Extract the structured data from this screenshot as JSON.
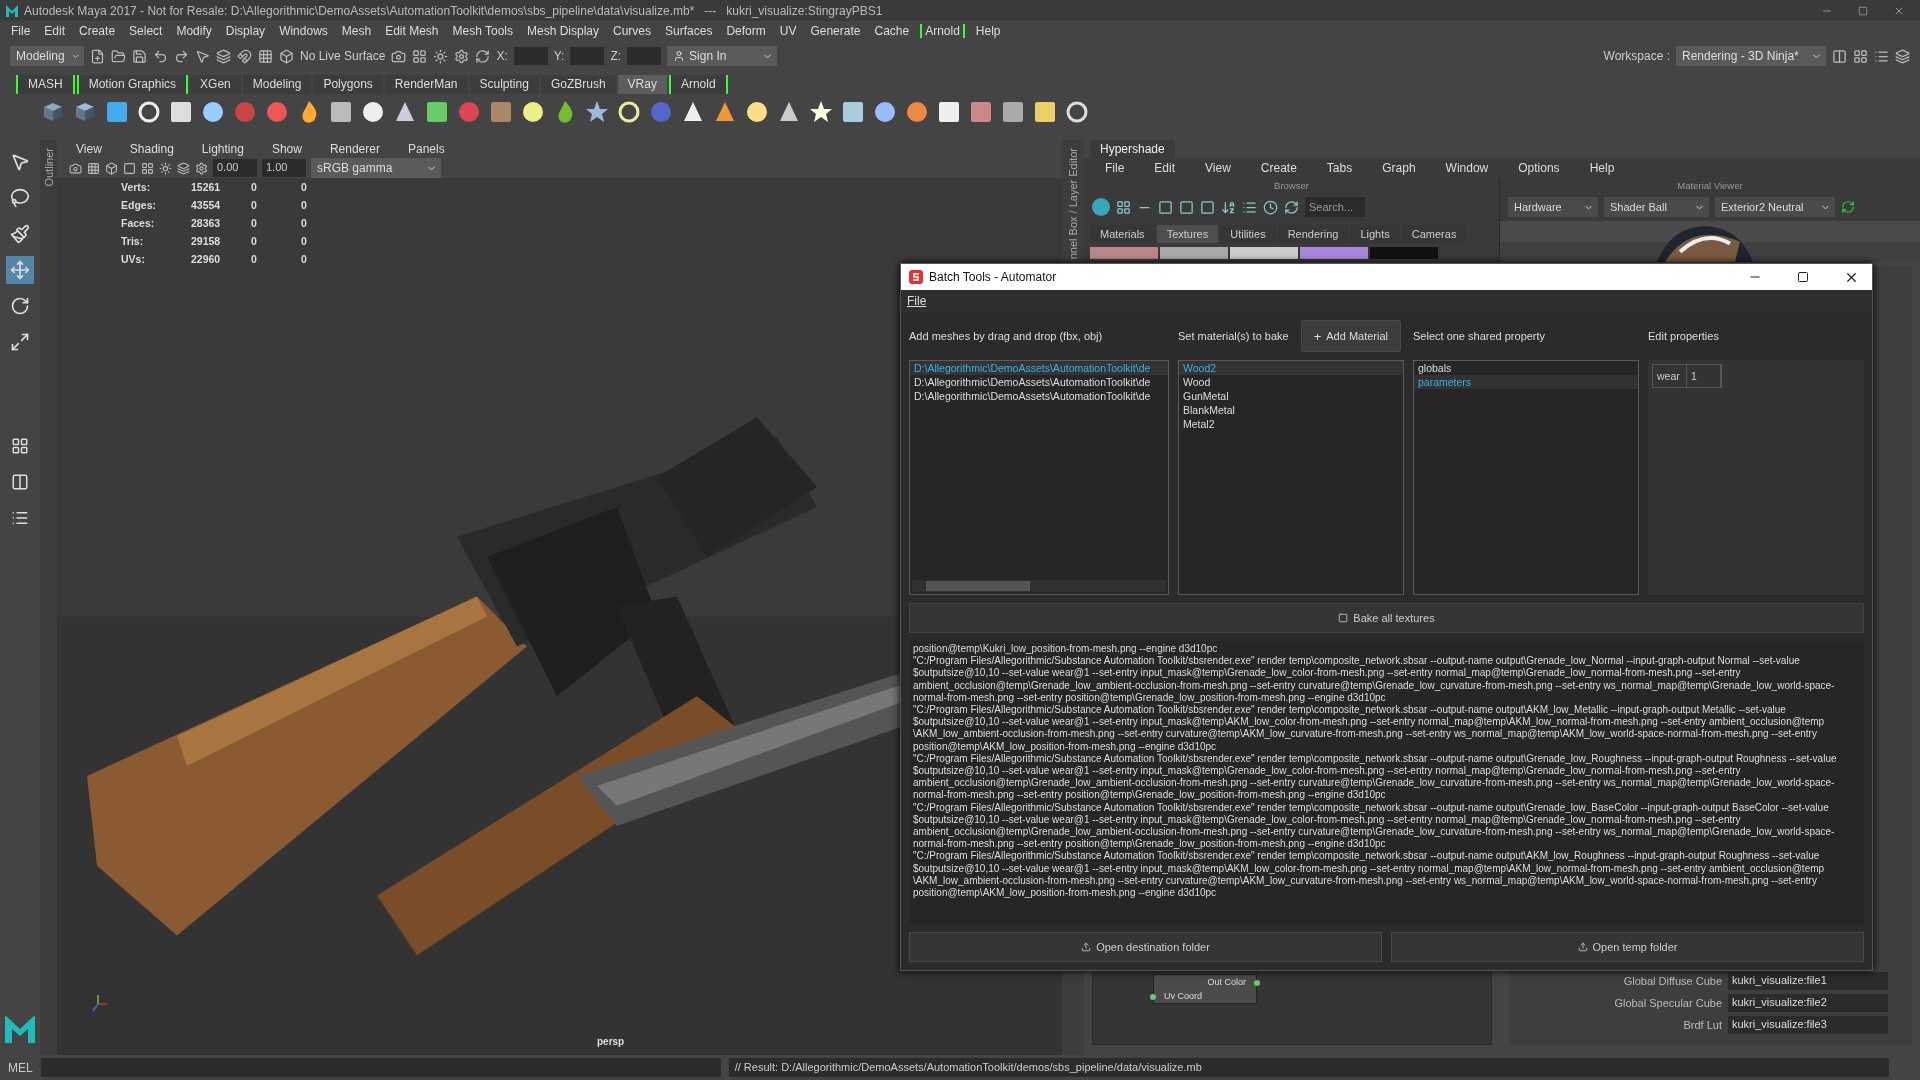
{
  "window": {
    "title": "Autodesk Maya 2017 - Not for Resale: D:\\Allegorithmic\\DemoAssets\\AutomationToolkit\\demos\\sbs_pipeline\\data\\visualize.mb*   ---   kukri_visualize:StingrayPBS1"
  },
  "menu_bar": [
    {
      "label": "File",
      "kind": "plain"
    },
    {
      "label": "Edit",
      "kind": "plain"
    },
    {
      "label": "Create",
      "kind": "plain"
    },
    {
      "label": "Select",
      "kind": "plain"
    },
    {
      "label": "Modify",
      "kind": "plain"
    },
    {
      "label": "Display",
      "kind": "plain"
    },
    {
      "label": "Windows",
      "kind": "plain"
    },
    {
      "label": "Mesh",
      "kind": "plain"
    },
    {
      "label": "Edit Mesh",
      "kind": "plain"
    },
    {
      "label": "Mesh Tools",
      "kind": "plain"
    },
    {
      "label": "Mesh Display",
      "kind": "plain"
    },
    {
      "label": "Curves",
      "kind": "plain"
    },
    {
      "label": "Surfaces",
      "kind": "plain"
    },
    {
      "label": "Deform",
      "kind": "plain"
    },
    {
      "label": "UV",
      "kind": "plain"
    },
    {
      "label": "Generate",
      "kind": "plain"
    },
    {
      "label": "Cache",
      "kind": "plain"
    },
    {
      "label": "Arnold",
      "kind": "plugin"
    },
    {
      "label": "Help",
      "kind": "plain"
    }
  ],
  "status_line": {
    "mode": "Modeling",
    "live_surface": "No Live Surface",
    "x_label": "X:",
    "y_label": "Y:",
    "z_label": "Z:",
    "sign_in": "Sign In",
    "workspace_label": "Workspace :",
    "workspace": "Rendering - 3D Ninja*"
  },
  "shelf_tabs": [
    {
      "label": "MASH",
      "kind": "plugin",
      "selected": false
    },
    {
      "label": "Motion Graphics",
      "kind": "plugin",
      "selected": false
    },
    {
      "label": "XGen",
      "kind": "plain",
      "selected": false
    },
    {
      "label": "Modeling",
      "kind": "plain",
      "selected": false
    },
    {
      "label": "Polygons",
      "kind": "plain",
      "selected": false
    },
    {
      "label": "RenderMan",
      "kind": "plain",
      "selected": false
    },
    {
      "label": "Sculpting",
      "kind": "plain",
      "selected": false
    },
    {
      "label": "GoZBrush",
      "kind": "plain",
      "selected": false
    },
    {
      "label": "VRay",
      "kind": "plain",
      "selected": true
    },
    {
      "label": "Arnold",
      "kind": "plugin",
      "selected": false
    }
  ],
  "outliner_tab": "Outliner",
  "viewport": {
    "menus": [
      "View",
      "Shading",
      "Lighting",
      "Show",
      "Renderer",
      "Panels"
    ],
    "exposure": "0.00",
    "gamma": "1.00",
    "color_space": "sRGB gamma",
    "stats": [
      {
        "label": "Verts:",
        "values": [
          "15261",
          "0",
          "0"
        ]
      },
      {
        "label": "Edges:",
        "values": [
          "43554",
          "0",
          "0"
        ]
      },
      {
        "label": "Faces:",
        "values": [
          "28363",
          "0",
          "0"
        ]
      },
      {
        "label": "Tris:",
        "values": [
          "29158",
          "0",
          "0"
        ]
      },
      {
        "label": "UVs:",
        "values": [
          "22960",
          "0",
          "0"
        ]
      }
    ],
    "camera": "persp"
  },
  "channel_box_tab": "nnel Box / Layer Editor",
  "hypershade": {
    "title": "Hypershade",
    "menus": [
      "File",
      "Edit",
      "View",
      "Create",
      "Tabs",
      "Graph",
      "Window",
      "Options",
      "Help"
    ],
    "browser_label": "Browser",
    "search_placeholder": "Search...",
    "tabs": [
      {
        "label": "Materials",
        "selected": false
      },
      {
        "label": "Textures",
        "selected": true
      },
      {
        "label": "Utilities",
        "selected": false
      },
      {
        "label": "Rendering",
        "selected": false
      },
      {
        "label": "Lights",
        "selected": false
      },
      {
        "label": "Cameras",
        "selected": false
      }
    ],
    "viewer_label": "Material Viewer",
    "renderer": "Hardware",
    "geometry": "Shader Ball",
    "environment": "Exterior2 Neutral",
    "node": {
      "output": "Out Color",
      "input": "Uv Coord"
    },
    "properties": [
      {
        "label": "Global Diffuse Cube",
        "value": "kukri_visualize:file1"
      },
      {
        "label": "Global Specular Cube",
        "value": "kukri_visualize:file2"
      },
      {
        "label": "Brdf Lut",
        "value": "kukri_visualize:file3"
      }
    ]
  },
  "command_line": {
    "language": "MEL",
    "result": "// Result: D:/Allegorithmic/DemoAssets/AutomationToolkit/demos/sbs_pipeline/data/visualize.mb"
  },
  "batch_tools": {
    "title": "Batch Tools - Automator",
    "menu": "File",
    "meshes_header": "Add meshes by drag and drop (fbx, obj)",
    "materials_header": "Set material(s) to bake",
    "add_material_icon": "+",
    "add_material": "Add Material",
    "property_header": "Select one shared property",
    "edit_header": "Edit properties",
    "meshes": [
      {
        "label": "D:\\Allegorithmic\\DemoAssets\\AutomationToolkit\\de",
        "selected": true
      },
      {
        "label": "D:\\Allegorithmic\\DemoAssets\\AutomationToolkit\\de",
        "selected": false
      },
      {
        "label": "D:\\Allegorithmic\\DemoAssets\\AutomationToolkit\\de",
        "selected": false
      }
    ],
    "materials": [
      {
        "label": "Wood2",
        "selected": true
      },
      {
        "label": "Wood",
        "selected": false
      },
      {
        "label": "GunMetal",
        "selected": false
      },
      {
        "label": "BlankMetal",
        "selected": false
      },
      {
        "label": "Metal2",
        "selected": false
      }
    ],
    "shared_properties": [
      {
        "label": "globals",
        "selected": false
      },
      {
        "label": "parameters",
        "selected": true
      }
    ],
    "edit_properties": [
      {
        "name": "wear",
        "value": "1"
      }
    ],
    "bake_button": "Bake all textures",
    "log": [
      "position@temp\\Kukri_low_position-from-mesh.png --engine d3d10pc",
      "\"C:/Program Files/Allegorithmic/Substance Automation Toolkit/sbsrender.exe\" render temp\\composite_network.sbsar --output-name output\\Grenade_low_Normal --input-graph-output Normal --set-value",
      "$outputsize@10,10 --set-value wear@1 --set-entry input_mask@temp\\Grenade_low_color-from-mesh.png --set-entry normal_map@temp\\Grenade_low_normal-from-mesh.png --set-entry",
      "ambient_occlusion@temp\\Grenade_low_ambient-occlusion-from-mesh.png --set-entry curvature@temp\\Grenade_low_curvature-from-mesh.png --set-entry ws_normal_map@temp\\Grenade_low_world-space-",
      "normal-from-mesh.png --set-entry position@temp\\Grenade_low_position-from-mesh.png --engine d3d10pc",
      "\"C:/Program Files/Allegorithmic/Substance Automation Toolkit/sbsrender.exe\" render temp\\composite_network.sbsar --output-name output\\AKM_low_Metallic --input-graph-output Metallic --set-value",
      "$outputsize@10,10 --set-value wear@1 --set-entry input_mask@temp\\AKM_low_color-from-mesh.png --set-entry normal_map@temp\\AKM_low_normal-from-mesh.png --set-entry ambient_occlusion@temp",
      "\\AKM_low_ambient-occlusion-from-mesh.png --set-entry curvature@temp\\AKM_low_curvature-from-mesh.png --set-entry ws_normal_map@temp\\AKM_low_world-space-normal-from-mesh.png --set-entry",
      "position@temp\\AKM_low_position-from-mesh.png --engine d3d10pc",
      "\"C:/Program Files/Allegorithmic/Substance Automation Toolkit/sbsrender.exe\" render temp\\composite_network.sbsar --output-name output\\Grenade_low_Roughness --input-graph-output Roughness --set-value",
      "$outputsize@10,10 --set-value wear@1 --set-entry input_mask@temp\\Grenade_low_color-from-mesh.png --set-entry normal_map@temp\\Grenade_low_normal-from-mesh.png --set-entry",
      "ambient_occlusion@temp\\Grenade_low_ambient-occlusion-from-mesh.png --set-entry curvature@temp\\Grenade_low_curvature-from-mesh.png --set-entry ws_normal_map@temp\\Grenade_low_world-space-",
      "normal-from-mesh.png --set-entry position@temp\\Grenade_low_position-from-mesh.png --engine d3d10pc",
      "\"C:/Program Files/Allegorithmic/Substance Automation Toolkit/sbsrender.exe\" render temp\\composite_network.sbsar --output-name output\\Grenade_low_BaseColor --input-graph-output BaseColor --set-value",
      "$outputsize@10,10 --set-value wear@1 --set-entry input_mask@temp\\Grenade_low_color-from-mesh.png --set-entry normal_map@temp\\Grenade_low_normal-from-mesh.png --set-entry",
      "ambient_occlusion@temp\\Grenade_low_ambient-occlusion-from-mesh.png --set-entry curvature@temp\\Grenade_low_curvature-from-mesh.png --set-entry ws_normal_map@temp\\Grenade_low_world-space-",
      "normal-from-mesh.png --set-entry position@temp\\Grenade_low_position-from-mesh.png --engine d3d10pc",
      "\"C:/Program Files/Allegorithmic/Substance Automation Toolkit/sbsrender.exe\" render temp\\composite_network.sbsar --output-name output\\AKM_low_Roughness --input-graph-output Roughness --set-value",
      "$outputsize@10,10 --set-value wear@1 --set-entry input_mask@temp\\AKM_low_color-from-mesh.png --set-entry normal_map@temp\\AKM_low_normal-from-mesh.png --set-entry ambient_occlusion@temp",
      "\\AKM_low_ambient-occlusion-from-mesh.png --set-entry curvature@temp\\AKM_low_curvature-from-mesh.png --set-entry ws_normal_map@temp\\AKM_low_world-space-normal-from-mesh.png --set-entry",
      "position@temp\\AKM_low_position-from-mesh.png --engine d3d10pc"
    ],
    "destination_button": "Open destination folder",
    "temp_button": "Open temp folder"
  }
}
